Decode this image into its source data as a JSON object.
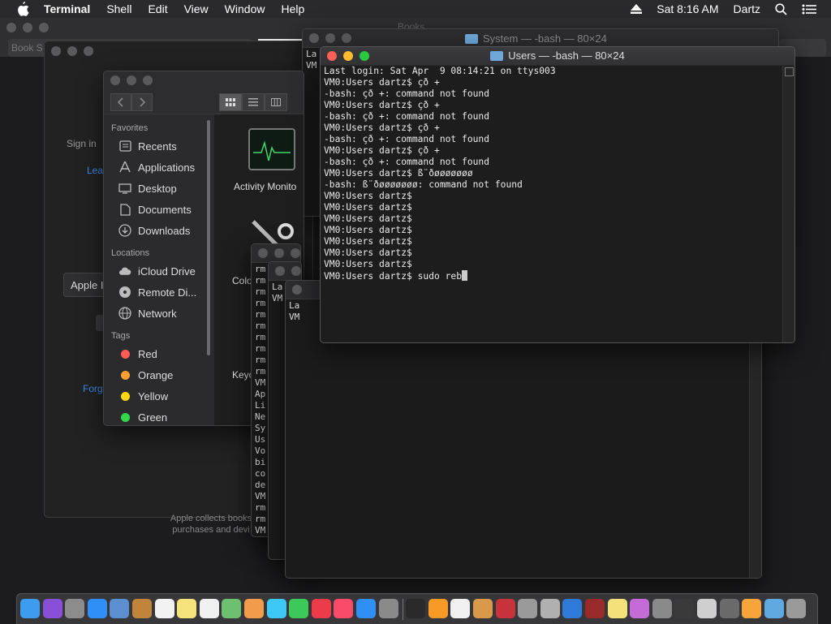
{
  "menubar": {
    "app_name": "Terminal",
    "menus": [
      "Shell",
      "Edit",
      "View",
      "Window",
      "Help"
    ],
    "clock": "Sat 8:16 AM",
    "user": "Dartz"
  },
  "books": {
    "title": "Books",
    "search_placeholder": "Book S",
    "sign_in": "Sign in",
    "learn_more": "Lea",
    "apple_id_field": "Apple I",
    "forgot": "Forg",
    "footer_line1": "Apple collects books",
    "footer_line2": "purchases and devi"
  },
  "finder": {
    "favorites_label": "Favorites",
    "favorites": [
      {
        "label": "Recents",
        "icon": "recents-icon"
      },
      {
        "label": "Applications",
        "icon": "applications-icon"
      },
      {
        "label": "Desktop",
        "icon": "desktop-icon"
      },
      {
        "label": "Documents",
        "icon": "documents-icon"
      },
      {
        "label": "Downloads",
        "icon": "downloads-icon"
      }
    ],
    "locations_label": "Locations",
    "locations": [
      {
        "label": "iCloud Drive",
        "icon": "icloud-icon"
      },
      {
        "label": "Remote Di...",
        "icon": "disc-icon"
      },
      {
        "label": "Network",
        "icon": "network-icon"
      }
    ],
    "tags_label": "Tags",
    "tags": [
      {
        "label": "Red",
        "color": "#ff5b57"
      },
      {
        "label": "Orange",
        "color": "#ff9f2f"
      },
      {
        "label": "Yellow",
        "color": "#ffd60a"
      },
      {
        "label": "Green",
        "color": "#32d74b"
      }
    ],
    "apps": {
      "activity_monitor": "Activity Monito",
      "colorsync": "Colo",
      "keychain": "Keyc"
    }
  },
  "system_terminal": {
    "title": "System — -bash — 80×24",
    "lines": [
      "La",
      "VM"
    ]
  },
  "bg_terminal_a": {
    "lines": [
      "rm",
      "rm",
      "rm",
      "rm",
      "rm",
      "rm",
      "rm",
      "rm",
      "rm",
      "rm",
      "VM",
      "Ap",
      "Li",
      "Ne",
      "Sy",
      "Us",
      "Vo",
      "bi",
      "co",
      "de",
      "VM",
      "rm",
      "rm",
      "VM"
    ]
  },
  "bg_terminal_b": {
    "lines": [
      "La",
      "VM"
    ]
  },
  "bg_terminal_c": {
    "lines": [
      "La",
      "VM"
    ]
  },
  "terminal": {
    "title": "Users — -bash — 80×24",
    "lines": [
      "Last login: Sat Apr  9 08:14:21 on ttys003",
      "VM0:Users dartz$ çð +",
      "-bash: çð +: command not found",
      "VM0:Users dartz$ çð +",
      "-bash: çð +: command not found",
      "VM0:Users dartz$ çð +",
      "-bash: çð +: command not found",
      "VM0:Users dartz$ çð +",
      "-bash: çð +: command not found",
      "VM0:Users dartz$ ß¨ðøøøøøøø",
      "-bash: ß¨ðøøøøøøø: command not found",
      "VM0:Users dartz$",
      "VM0:Users dartz$",
      "VM0:Users dartz$",
      "VM0:Users dartz$",
      "VM0:Users dartz$",
      "VM0:Users dartz$",
      "VM0:Users dartz$",
      "VM0:Users dartz$ sudo reb"
    ]
  },
  "dock": {
    "items": [
      {
        "name": "finder-icon",
        "color": "#3d9bf0"
      },
      {
        "name": "siri-icon",
        "color": "#8a4fd8"
      },
      {
        "name": "launchpad-icon",
        "color": "#8c8c8c"
      },
      {
        "name": "safari-icon",
        "color": "#2f8ff5"
      },
      {
        "name": "preview-icon",
        "color": "#5b8fd0"
      },
      {
        "name": "notebook-icon",
        "color": "#c0853a"
      },
      {
        "name": "calendar-icon",
        "color": "#f2f2f2"
      },
      {
        "name": "notes-icon",
        "color": "#f5e27a"
      },
      {
        "name": "reminders-icon",
        "color": "#f0f0f0"
      },
      {
        "name": "maps-icon",
        "color": "#6cc070"
      },
      {
        "name": "photos-icon",
        "color": "#f29b4a"
      },
      {
        "name": "messages-icon",
        "color": "#3ec8f5"
      },
      {
        "name": "facetime-icon",
        "color": "#3cc95a"
      },
      {
        "name": "news-icon",
        "color": "#ee3b4a"
      },
      {
        "name": "music-icon",
        "color": "#fa4a6a"
      },
      {
        "name": "app-store-icon",
        "color": "#2f8ff5"
      },
      {
        "name": "system-preferences-icon",
        "color": "#8a8a8a"
      },
      {
        "name": "terminal-icon",
        "color": "#2a2a2a"
      },
      {
        "name": "books-icon",
        "color": "#f79a26"
      },
      {
        "name": "textedit-icon",
        "color": "#f0f0f0"
      },
      {
        "name": "stickies-icon",
        "color": "#d89a4a"
      },
      {
        "name": "photo-booth-icon",
        "color": "#c8323a"
      },
      {
        "name": "automator-icon",
        "color": "#9a9a9a"
      },
      {
        "name": "disk-utility-icon",
        "color": "#b0b0b0"
      },
      {
        "name": "edge-icon",
        "color": "#2f7ad8"
      },
      {
        "name": "dictionary-icon",
        "color": "#9a2a2a"
      },
      {
        "name": "stickies-notes-icon",
        "color": "#f3e27a"
      },
      {
        "name": "script-editor-icon",
        "color": "#c46bd8"
      },
      {
        "name": "font-book-icon",
        "color": "#8a8a8a"
      },
      {
        "name": "activity-monitor-icon",
        "color": "#3a3a3a"
      },
      {
        "name": "console-icon",
        "color": "#cfcfcf"
      },
      {
        "name": "chess-icon",
        "color": "#6a6a6a"
      },
      {
        "name": "home-icon",
        "color": "#f7a53a"
      },
      {
        "name": "downloads-folder-icon",
        "color": "#5fa8e0"
      },
      {
        "name": "trash-icon",
        "color": "#9a9a9a"
      }
    ]
  }
}
